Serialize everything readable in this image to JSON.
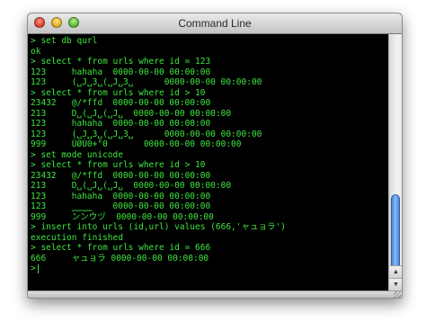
{
  "window": {
    "title": "Command Line"
  },
  "terminal": {
    "lines": [
      "> set db qurl",
      "ok",
      "> select * from urls where id = 123",
      "123     hahaha  0000-00-00 00:00:00",
      "123     (␣J␣3␣(␣J␣3␣      0000-00-00 00:00:00",
      "> select * from urls where id > 10",
      "23432   @/*ffd  0000-00-00 00:00:00",
      "213     D␣(␣J␣(␣J␣  0000-00-00 00:00:00",
      "123     hahaha  0000-00-00 00:00:00",
      "123     (␣J␣3␣(␣J␣3␣      0000-00-00 00:00:00",
      "999     ÙØÙ0+°0       0000-00-00 00:00:00",
      "> set mode unicode",
      "> select * from urls where id > 10",
      "23432   @/*ffd  0000-00-00 00:00:00",
      "213     D␣(␣J␣(␣J␣  0000-00-00 00:00:00",
      "123     hahaha  0000-00-00 00:00:00",
      "123     ‗‗‗‗    0000-00-00 00:00:00",
      "999     ンンウヅ  0000-00-00 00:00:00",
      "> insert into urls (id,url) values (666,'ャュョラ')",
      "execution finished",
      "> select * from urls where id = 666",
      "666     ャュョラ 0000-00-00 00:00:00"
    ],
    "prompt": ">"
  },
  "colors": {
    "terminal_text": "#3ee63e",
    "terminal_bg": "#000000",
    "scroll_thumb": "#5a95e0"
  },
  "icons": {
    "close": "close-icon",
    "minimize": "minimize-icon",
    "zoom": "zoom-icon",
    "scroll_up": "arrow-up-icon",
    "scroll_down": "arrow-down-icon"
  }
}
